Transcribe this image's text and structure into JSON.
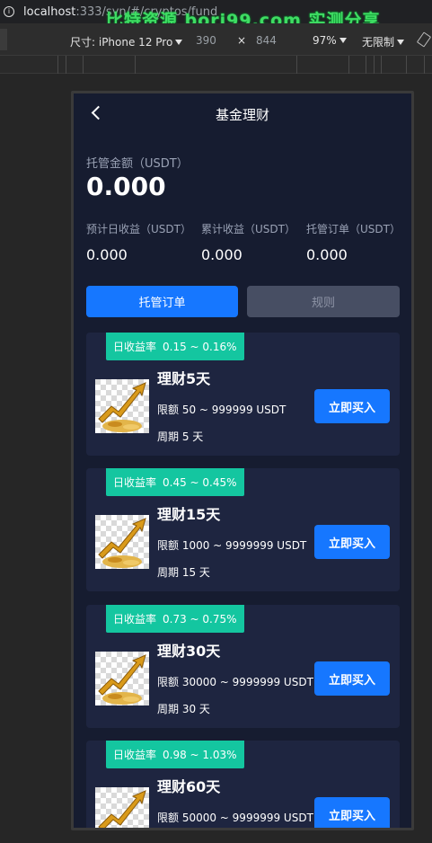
{
  "browser": {
    "host": "localhost",
    "path": ":333/syn/#/cryptos/fund",
    "watermark": "比特资源 bori99.com 实测分享"
  },
  "devtools": {
    "device_label": "尺寸: iPhone 12 Pro",
    "width": "390",
    "times": "×",
    "height": "844",
    "zoom": "97%",
    "throttle": "无限制"
  },
  "app": {
    "title": "基金理财",
    "custody_label": "托管金额（USDT）",
    "custody_value": "0.000",
    "stats": [
      {
        "label": "预计日收益（USDT）",
        "value": "0.000"
      },
      {
        "label": "累计收益（USDT）",
        "value": "0.000"
      },
      {
        "label": "托管订单（USDT）",
        "value": "0.000"
      }
    ],
    "tabs": [
      {
        "label": "托管订单"
      },
      {
        "label": "规则"
      }
    ],
    "products": [
      {
        "badge_label": "日收益率",
        "rate": "0.15 ~ 0.16%",
        "name": "理财5天",
        "limit": "限额 50 ~ 999999 USDT",
        "period": "周期 5 天",
        "button": "立即买入"
      },
      {
        "badge_label": "日收益率",
        "rate": "0.45 ~ 0.45%",
        "name": "理财15天",
        "limit": "限额 1000 ~ 9999999 USDT",
        "period": "周期 15 天",
        "button": "立即买入"
      },
      {
        "badge_label": "日收益率",
        "rate": "0.73 ~ 0.75%",
        "name": "理财30天",
        "limit": "限额 30000 ~ 9999999 USDT",
        "period": "周期 30 天",
        "button": "立即买入"
      },
      {
        "badge_label": "日收益率",
        "rate": "0.98 ~ 1.03%",
        "name": "理财60天",
        "limit": "限额 50000 ~ 9999999 USDT",
        "period": "",
        "button": "立即买入"
      }
    ],
    "colors": {
      "background": "#161c30",
      "card": "#1e2540",
      "accent": "#1677ff",
      "badge": "#14c6a0"
    }
  }
}
